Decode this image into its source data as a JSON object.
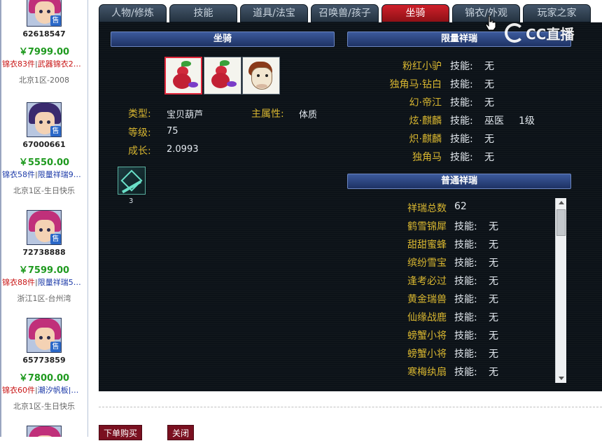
{
  "listings": [
    {
      "id": "62618547",
      "price": "￥7999.00",
      "tag1": "锦衣83件",
      "sep": "|",
      "tag2": "武器锦衣2…",
      "server": "北京1区-2008",
      "sell": "售"
    },
    {
      "id": "67000661",
      "price": "￥5550.00",
      "tag1": "锦衣58件",
      "sep": "|",
      "tag2": "限量祥瑞9…",
      "server": "北京1区-生日快乐",
      "sell": "售"
    },
    {
      "id": "72738888",
      "price": "￥7599.00",
      "tag1": "锦衣88件",
      "sep": "|",
      "tag2": "限量祥瑞5…",
      "server": "浙江1区-台州湾",
      "sell": "售"
    },
    {
      "id": "65773859",
      "price": "￥7800.00",
      "tag1": "锦衣60件",
      "sep": "|",
      "tag2": "潮汐帆板|…",
      "server": "北京1区-生日快乐",
      "sell": "售"
    }
  ],
  "tabs": [
    "人物/修炼",
    "技能",
    "道具/法宝",
    "召唤兽/孩子",
    "坐骑",
    "锦衣/外观",
    "玩家之家"
  ],
  "active_tab": "坐骑",
  "mount": {
    "header": "坐骑",
    "type_label": "类型:",
    "type_value": "宝贝葫芦",
    "attr_label": "主属性:",
    "attr_value": "体质",
    "level_label": "等级:",
    "level_value": "75",
    "growth_label": "成长:",
    "growth_value": "2.0993",
    "skill_count": "3"
  },
  "limited": {
    "header": "限量祥瑞",
    "items": [
      {
        "name": "粉红小驴",
        "skill_label": "技能:",
        "value": "无"
      },
      {
        "name": "独角马·钻白",
        "skill_label": "技能:",
        "value": "无"
      },
      {
        "name": "幻·帝江",
        "skill_label": "技能:",
        "value": "无"
      },
      {
        "name": "炫·麒麟",
        "skill_label": "技能:",
        "value": "巫医",
        "level": "1级"
      },
      {
        "name": "炽·麒麟",
        "skill_label": "技能:",
        "value": "无"
      },
      {
        "name": "独角马",
        "skill_label": "技能:",
        "value": "无"
      }
    ]
  },
  "normal": {
    "header": "普通祥瑞",
    "total_label": "祥瑞总数",
    "total_value": "62",
    "items": [
      {
        "name": "鹤雪锦犀",
        "skill_label": "技能:",
        "value": "无"
      },
      {
        "name": "甜甜蜜蜂",
        "skill_label": "技能:",
        "value": "无"
      },
      {
        "name": "缤纷雪宝",
        "skill_label": "技能:",
        "value": "无"
      },
      {
        "name": "逢考必过",
        "skill_label": "技能:",
        "value": "无"
      },
      {
        "name": "黄金瑞兽",
        "skill_label": "技能:",
        "value": "无"
      },
      {
        "name": "仙缘战鹿",
        "skill_label": "技能:",
        "value": "无"
      },
      {
        "name": "螃蟹小将",
        "skill_label": "技能:",
        "value": "无"
      },
      {
        "name": "螃蟹小将",
        "skill_label": "技能:",
        "value": "无"
      },
      {
        "name": "寒梅纨扇",
        "skill_label": "技能:",
        "value": "无"
      }
    ]
  },
  "buttons": {
    "buy": "下单购买",
    "close": "关闭"
  },
  "watermark": "CC直播",
  "colors": {
    "gold_label": "#d8b630",
    "panel_bg": "#0c1218",
    "active_tab": "#c81c26",
    "price_green": "#1f9a1f"
  }
}
